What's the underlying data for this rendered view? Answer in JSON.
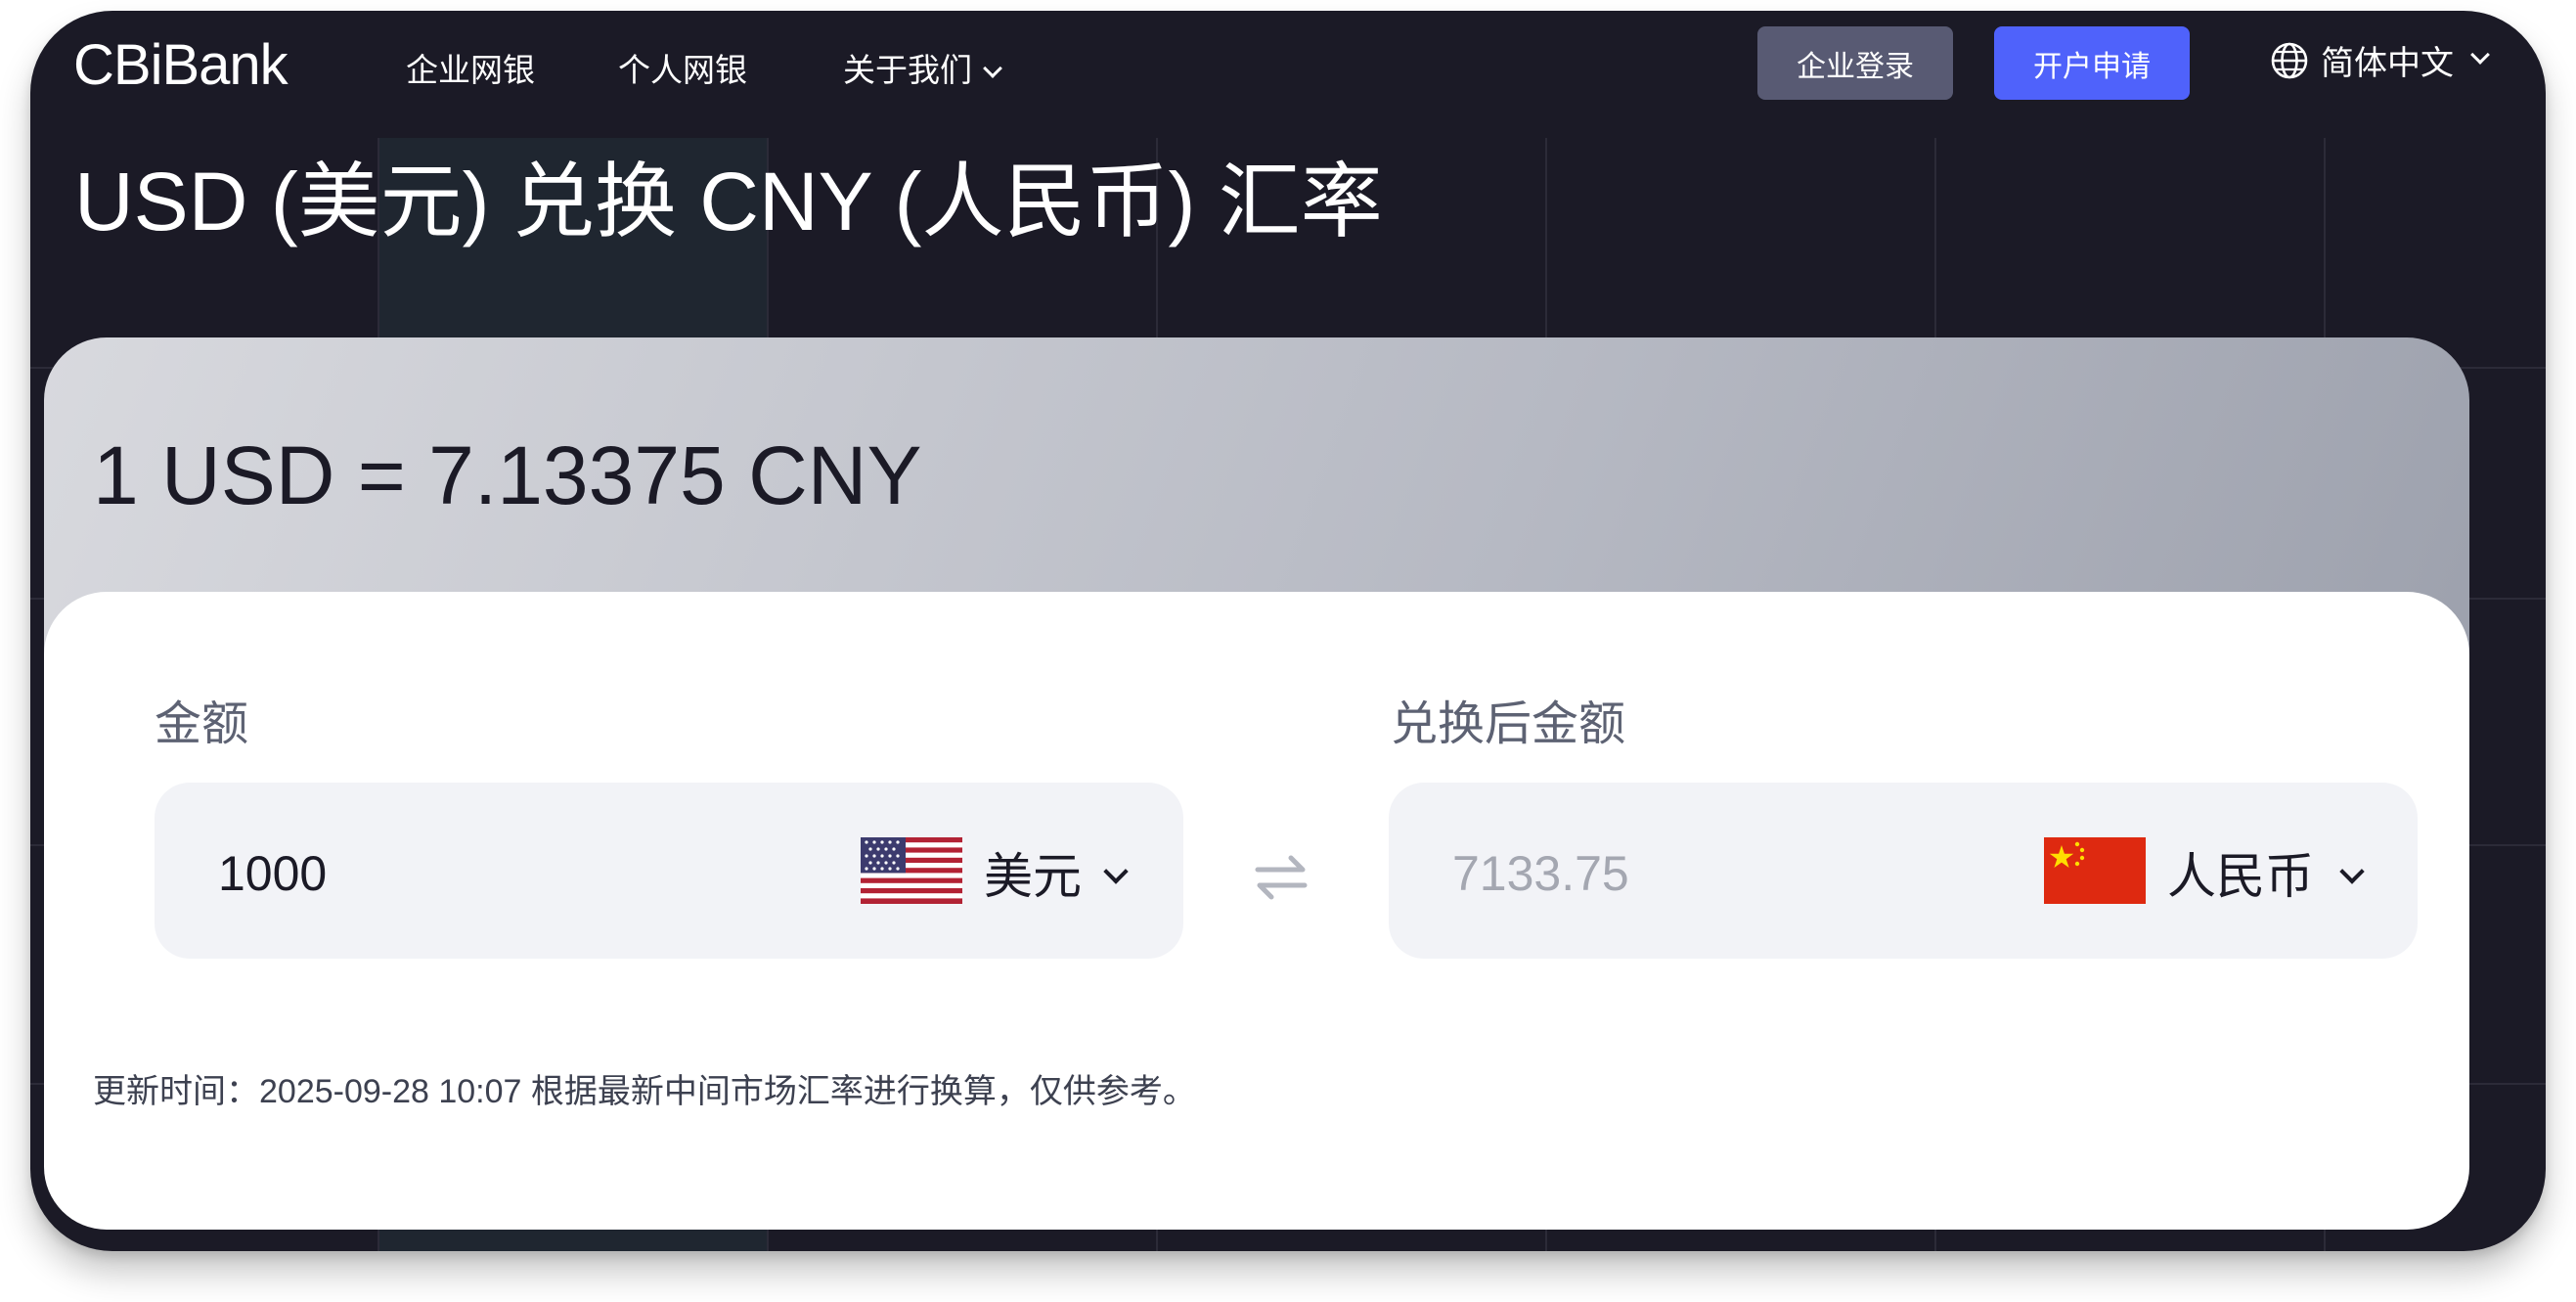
{
  "nav": {
    "logo": "CBiBank",
    "items": [
      {
        "label": "企业网银"
      },
      {
        "label": "个人网银"
      },
      {
        "label": "关于我们"
      }
    ],
    "login_button": "企业登录",
    "open_account_button": "开户申请",
    "language": "简体中文"
  },
  "page": {
    "title": "USD (美元) 兑换 CNY (人民币) 汇率"
  },
  "converter": {
    "rate_text": "1 USD = 7.13375 CNY",
    "amount_label": "金额",
    "amount_value": "1000",
    "from_currency": "美元",
    "converted_label": "兑换后金额",
    "converted_value": "7133.75",
    "to_currency": "人民币",
    "update_note": "更新时间：2025-09-28 10:07 根据最新中间市场汇率进行换算，仅供参考。"
  },
  "colors": {
    "background": "#1b1a26",
    "primary_button": "#4f62fb",
    "secondary_button": "#585a73"
  },
  "icons": {
    "language": "globe-icon",
    "swap": "swap-arrows-icon",
    "dropdown": "chevron-down-icon",
    "from_flag": "us-flag-icon",
    "to_flag": "china-flag-icon"
  }
}
